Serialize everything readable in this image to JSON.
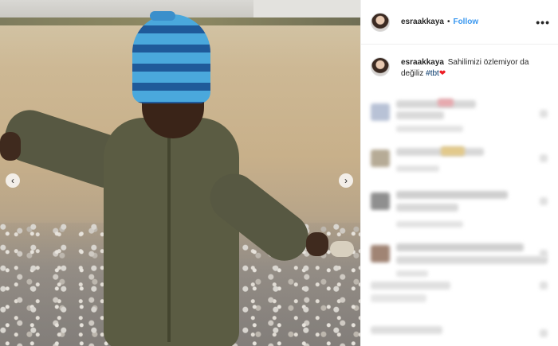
{
  "post": {
    "username": "esraakkaya",
    "separator": "•",
    "follow_label": "Follow",
    "more_icon": "more-dots-icon",
    "more_label": "•••",
    "caption": {
      "username": "esraakkaya",
      "text": "Sahilimizi özlemiyor da değiliz ",
      "hashtag": "#tbt",
      "emoji": "❤"
    },
    "nav": {
      "prev_label": "‹",
      "next_label": "›"
    }
  },
  "colors": {
    "follow": "#3897f0",
    "hashtag": "#003569",
    "heart": "#ed1c24"
  }
}
